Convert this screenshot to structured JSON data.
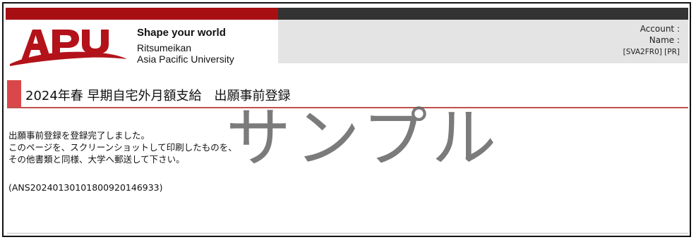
{
  "header": {
    "logo_text": "APU",
    "tagline": "Shape your world",
    "university_line1": "Ritsumeikan",
    "university_line2": "Asia Pacific University",
    "account_label": "Account :",
    "name_label": "Name :",
    "screen_code": "[SVA2FR0] [PR]"
  },
  "colors": {
    "brand_red": "#a80f13",
    "dark_bar": "#333333",
    "accent_red": "#d9474a",
    "panel_gray": "#e4e4e4"
  },
  "page": {
    "title": "2024年春 早期自宅外月額支給　出願事前登録"
  },
  "message": {
    "line1": "出願事前登録を登録完了しました。",
    "line2": "このページを、スクリーンショットして印刷したものを、",
    "line3": "その他書類と同様、大学へ郵送して下さい。",
    "receipt_number": "(ANS2024013010180092014693​3)"
  },
  "watermark": {
    "text": "サンプル"
  }
}
